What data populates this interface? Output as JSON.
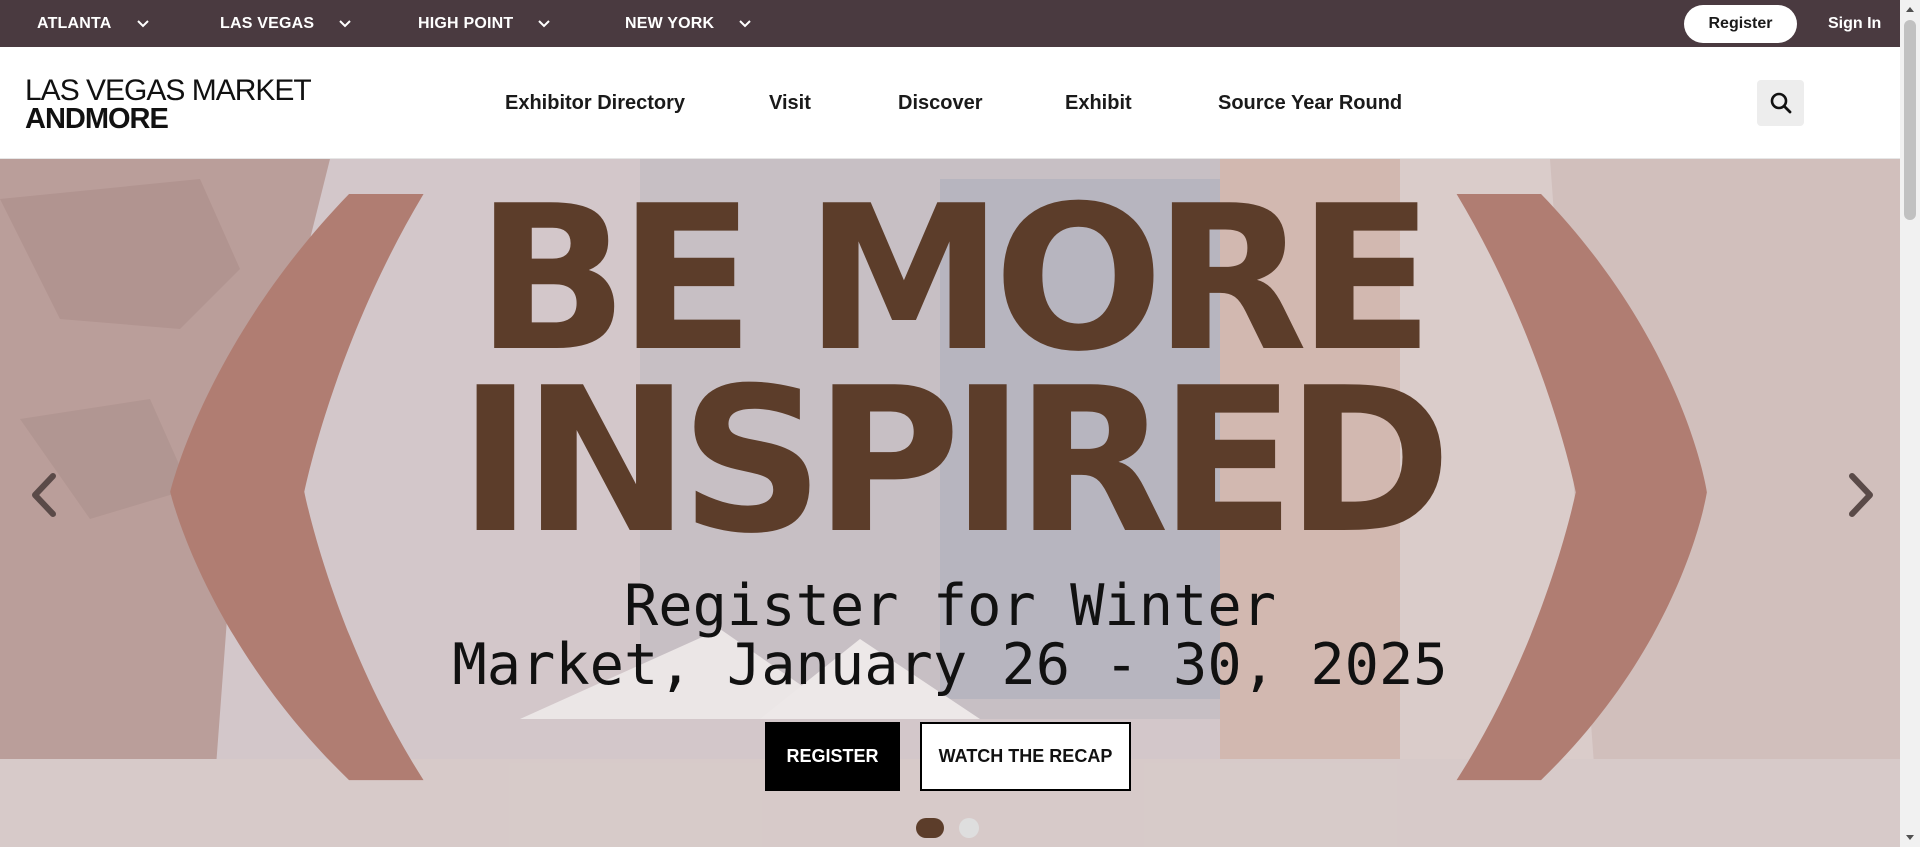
{
  "topbar": {
    "markets": [
      {
        "label": "ATLANTA"
      },
      {
        "label": "LAS VEGAS"
      },
      {
        "label": "HIGH POINT"
      },
      {
        "label": "NEW YORK"
      }
    ],
    "register_label": "Register",
    "signin_label": "Sign In"
  },
  "logo": {
    "line1": "LAS VEGAS MARKET",
    "line2": "ANDMORE"
  },
  "nav": {
    "items": [
      {
        "label": "Exhibitor Directory"
      },
      {
        "label": "Visit"
      },
      {
        "label": "Discover"
      },
      {
        "label": "Exhibit"
      },
      {
        "label": "Source Year Round"
      }
    ],
    "search_icon": "search-icon"
  },
  "hero": {
    "headline_line1": "BE MORE",
    "headline_line2": "INSPIRED",
    "subhead_line1": "Register for Winter",
    "subhead_line2": "Market, January 26 - 30, 2025",
    "register_button": "REGISTER",
    "recap_button": "WATCH THE RECAP",
    "slide_count": 2,
    "active_slide": 1,
    "colors": {
      "headline": "#5c3d2a",
      "bracket": "#b07d72",
      "topbar": "#4a3a40"
    }
  }
}
